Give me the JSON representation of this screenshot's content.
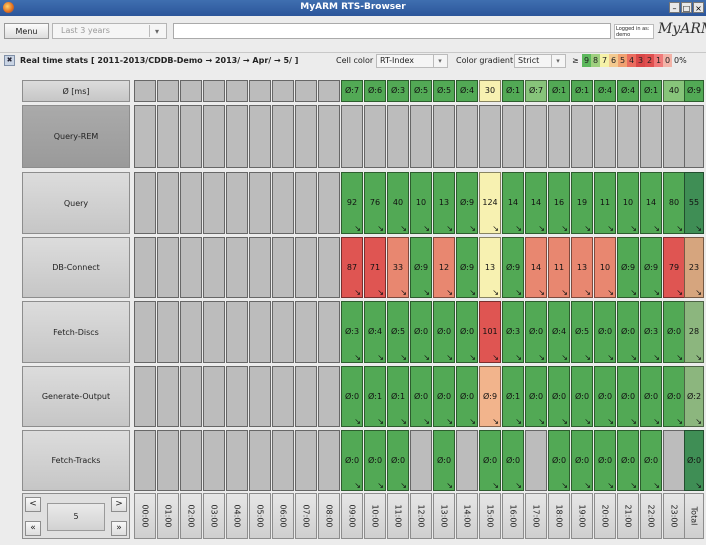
{
  "window": {
    "title": "MyARM RTS-Browser"
  },
  "toolbar": {
    "menu_label": "Menu",
    "period_placeholder": "Last 3 years",
    "logged_in_label": "Logged in as:",
    "logged_in_user": "demo",
    "logo_text": "MyARM"
  },
  "stats": {
    "title": "Real time stats [ 2011-2013/CDDB-Demo → 2013/ → Apr/ → 5/ ]",
    "cell_color_label": "Cell color",
    "cell_color_value": "RT-Index",
    "gradient_label": "Color gradient",
    "gradient_value": "Strict",
    "legend_ge": "≥",
    "legend": [
      {
        "label": "9",
        "color": "#5cb85c"
      },
      {
        "label": "8",
        "color": "#9fd07f"
      },
      {
        "label": "7",
        "color": "#f5f1a8"
      },
      {
        "label": "6",
        "color": "#f3c98f"
      },
      {
        "label": "5",
        "color": "#f0a070"
      },
      {
        "label": "4",
        "color": "#ea6c5e"
      },
      {
        "label": "3",
        "color": "#d94848"
      },
      {
        "label": "2",
        "color": "#e05050"
      },
      {
        "label": "1",
        "color": "#f07a7a"
      },
      {
        "label": "0",
        "color": "#f3b3a8"
      }
    ],
    "legend_pct": "0%"
  },
  "colors": {
    "g": "#52a955",
    "lg": "#87c47a",
    "y": "#f7f1b1",
    "o": "#f2b48c",
    "r": "#df5552",
    "lr": "#e88770",
    "dg": "#3f8e55",
    "tg": "#8cb67e",
    "tan": "#d6a57e",
    "empty": "#bcbcbc"
  },
  "rows": [
    {
      "name": "Ø [ms]",
      "cells": [
        {
          "v": "Ø:7",
          "c": "g"
        },
        {
          "v": "Ø:6",
          "c": "g"
        },
        {
          "v": "Ø:3",
          "c": "g"
        },
        {
          "v": "Ø:5",
          "c": "g"
        },
        {
          "v": "Ø:5",
          "c": "g"
        },
        {
          "v": "Ø:4",
          "c": "g"
        },
        {
          "v": "30",
          "c": "y"
        },
        {
          "v": "Ø:1",
          "c": "g"
        },
        {
          "v": "Ø:7",
          "c": "lg"
        },
        {
          "v": "Ø:1",
          "c": "g"
        },
        {
          "v": "Ø:1",
          "c": "g"
        },
        {
          "v": "Ø:4",
          "c": "g"
        },
        {
          "v": "Ø:4",
          "c": "g"
        },
        {
          "v": "Ø:1",
          "c": "g"
        },
        {
          "v": "40",
          "c": "lg"
        }
      ],
      "total": {
        "v": "Ø:9",
        "c": "g"
      }
    },
    {
      "name": "Query-REM",
      "active": true,
      "cells": [],
      "total": null
    },
    {
      "name": "Query",
      "cells": [
        {
          "v": "92",
          "c": "g"
        },
        {
          "v": "76",
          "c": "g"
        },
        {
          "v": "40",
          "c": "g"
        },
        {
          "v": "10",
          "c": "g"
        },
        {
          "v": "13",
          "c": "g"
        },
        {
          "v": "Ø:9",
          "c": "g"
        },
        {
          "v": "124",
          "c": "y"
        },
        {
          "v": "14",
          "c": "g"
        },
        {
          "v": "14",
          "c": "g"
        },
        {
          "v": "16",
          "c": "g"
        },
        {
          "v": "19",
          "c": "g"
        },
        {
          "v": "11",
          "c": "g"
        },
        {
          "v": "10",
          "c": "g"
        },
        {
          "v": "14",
          "c": "g"
        },
        {
          "v": "80",
          "c": "g"
        }
      ],
      "total": {
        "v": "55",
        "c": "dg"
      }
    },
    {
      "name": "DB-Connect",
      "cells": [
        {
          "v": "87",
          "c": "r"
        },
        {
          "v": "71",
          "c": "r"
        },
        {
          "v": "33",
          "c": "lr"
        },
        {
          "v": "Ø:9",
          "c": "g"
        },
        {
          "v": "12",
          "c": "lr"
        },
        {
          "v": "Ø:9",
          "c": "g"
        },
        {
          "v": "13",
          "c": "y"
        },
        {
          "v": "Ø:9",
          "c": "g"
        },
        {
          "v": "14",
          "c": "lr"
        },
        {
          "v": "11",
          "c": "lr"
        },
        {
          "v": "13",
          "c": "lr"
        },
        {
          "v": "10",
          "c": "lr"
        },
        {
          "v": "Ø:9",
          "c": "g"
        },
        {
          "v": "Ø:9",
          "c": "g"
        },
        {
          "v": "79",
          "c": "r"
        }
      ],
      "total": {
        "v": "23",
        "c": "tan"
      }
    },
    {
      "name": "Fetch-Discs",
      "cells": [
        {
          "v": "Ø:3",
          "c": "g"
        },
        {
          "v": "Ø:4",
          "c": "g"
        },
        {
          "v": "Ø:5",
          "c": "g"
        },
        {
          "v": "Ø:0",
          "c": "g"
        },
        {
          "v": "Ø:0",
          "c": "g"
        },
        {
          "v": "Ø:0",
          "c": "g"
        },
        {
          "v": "101",
          "c": "r"
        },
        {
          "v": "Ø:3",
          "c": "g"
        },
        {
          "v": "Ø:0",
          "c": "g"
        },
        {
          "v": "Ø:4",
          "c": "g"
        },
        {
          "v": "Ø:5",
          "c": "g"
        },
        {
          "v": "Ø:0",
          "c": "g"
        },
        {
          "v": "Ø:0",
          "c": "g"
        },
        {
          "v": "Ø:3",
          "c": "g"
        },
        {
          "v": "Ø:0",
          "c": "g"
        }
      ],
      "total": {
        "v": "28",
        "c": "tg"
      }
    },
    {
      "name": "Generate-Output",
      "cells": [
        {
          "v": "Ø:0",
          "c": "g"
        },
        {
          "v": "Ø:1",
          "c": "g"
        },
        {
          "v": "Ø:1",
          "c": "g"
        },
        {
          "v": "Ø:0",
          "c": "g"
        },
        {
          "v": "Ø:0",
          "c": "g"
        },
        {
          "v": "Ø:0",
          "c": "g"
        },
        {
          "v": "Ø:9",
          "c": "o"
        },
        {
          "v": "Ø:1",
          "c": "g"
        },
        {
          "v": "Ø:0",
          "c": "g"
        },
        {
          "v": "Ø:0",
          "c": "g"
        },
        {
          "v": "Ø:0",
          "c": "g"
        },
        {
          "v": "Ø:0",
          "c": "g"
        },
        {
          "v": "Ø:0",
          "c": "g"
        },
        {
          "v": "Ø:0",
          "c": "g"
        },
        {
          "v": "Ø:0",
          "c": "g"
        }
      ],
      "total": {
        "v": "Ø:2",
        "c": "tg"
      }
    },
    {
      "name": "Fetch-Tracks",
      "cells": [
        {
          "v": "Ø:0",
          "c": "g"
        },
        {
          "v": "Ø:0",
          "c": "g"
        },
        {
          "v": "Ø:0",
          "c": "g"
        },
        null,
        {
          "v": "Ø:0",
          "c": "g"
        },
        null,
        {
          "v": "Ø:0",
          "c": "g"
        },
        {
          "v": "Ø:0",
          "c": "g"
        },
        null,
        {
          "v": "Ø:0",
          "c": "g"
        },
        {
          "v": "Ø:0",
          "c": "g"
        },
        {
          "v": "Ø:0",
          "c": "g"
        },
        {
          "v": "Ø:0",
          "c": "g"
        },
        {
          "v": "Ø:0",
          "c": "g"
        },
        null
      ],
      "total": {
        "v": "Ø:0",
        "c": "dg"
      }
    }
  ],
  "hours": [
    "00:00",
    "01:00",
    "02:00",
    "03:00",
    "04:00",
    "05:00",
    "06:00",
    "07:00",
    "08:00",
    "09:00",
    "10:00",
    "11:00",
    "12:00",
    "13:00",
    "14:00",
    "15:00",
    "16:00",
    "17:00",
    "18:00",
    "19:00",
    "20:00",
    "21:00",
    "22:00",
    "23:00"
  ],
  "total_label": "Total",
  "nav": {
    "page": "5",
    "prev": "<",
    "next": ">",
    "first": "«",
    "last": "»"
  }
}
